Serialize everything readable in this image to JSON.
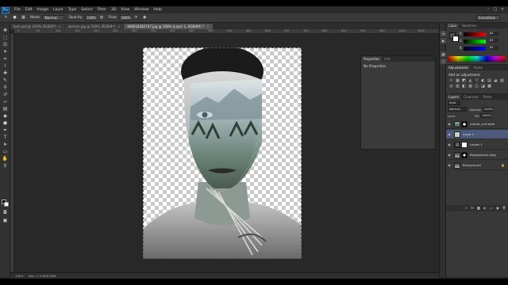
{
  "app": {
    "logo": "Ps"
  },
  "menu": [
    "File",
    "Edit",
    "Image",
    "Layer",
    "Type",
    "Select",
    "Filter",
    "3D",
    "View",
    "Window",
    "Help"
  ],
  "window_controls": [
    "–",
    "□",
    "×"
  ],
  "options_bar": {
    "mode_label": "Mode:",
    "mode_value": "Normal",
    "opacity_label": "Opacity:",
    "opacity_value": "100%",
    "flow_label": "Flow:",
    "flow_value": "100%",
    "workspace": "Essentials"
  },
  "tabs": [
    {
      "label": "look.psd @ 100% (RGB/8*)",
      "close": "×"
    },
    {
      "label": "woman.jpg @ 100% (RGB/8*)",
      "close": "×"
    },
    {
      "label": "908934282747.jpg @ 100% (Layer 1, RGB/8#) *",
      "close": "×"
    }
  ],
  "ruler_ticks": [
    "0",
    "50",
    "100",
    "150",
    "200",
    "250",
    "300",
    "350",
    "400",
    "450",
    "500",
    "550",
    "600",
    "650",
    "700",
    "750",
    "800",
    "850",
    "900",
    "950",
    "1000",
    "1050"
  ],
  "properties": {
    "tabs": [
      "Properties",
      "Info"
    ],
    "body": "No Properties"
  },
  "color_panel": {
    "tabs": [
      "Color",
      "Swatches"
    ],
    "rows": [
      {
        "label": "R",
        "value": "85"
      },
      {
        "label": "G",
        "value": "85"
      },
      {
        "label": "B",
        "value": "85"
      }
    ]
  },
  "adjustments": {
    "tabs": [
      "Adjustments",
      "Styles"
    ],
    "title": "Add an adjustment",
    "icons": [
      "☼",
      "▦",
      "◩",
      "◭",
      "▽",
      "◐",
      "▤",
      "◒",
      "▧",
      "◎",
      "▥",
      "◧",
      "▨",
      "◫",
      "◪",
      "▩"
    ]
  },
  "layers": {
    "tabs": [
      "Layers",
      "Channels",
      "Paths"
    ],
    "kind_label": "Kind",
    "blend": "Normal",
    "opacity_label": "Opacity:",
    "opacity": "100%",
    "lock_label": "Lock:",
    "fill_label": "Fill:",
    "fill": "100%",
    "items": [
      {
        "name": "nature_cell-wide",
        "selected": false,
        "has_mask": true
      },
      {
        "name": "Layer 1",
        "selected": true,
        "has_mask": false
      },
      {
        "name": "Levels 1",
        "selected": false,
        "has_mask": false
      },
      {
        "name": "Background copy",
        "selected": false,
        "has_mask": true
      },
      {
        "name": "Background",
        "selected": false,
        "has_mask": false
      }
    ],
    "footer_icons": [
      "∞",
      "fx",
      "◙",
      "◐",
      "▭",
      "▣",
      "🗑"
    ]
  },
  "status": {
    "zoom": "100%",
    "doc": "Doc: 1.37M/6.46M"
  },
  "colors": {
    "accent": "#4b5a7a",
    "panel": "#383838",
    "canvas": "#282828"
  }
}
